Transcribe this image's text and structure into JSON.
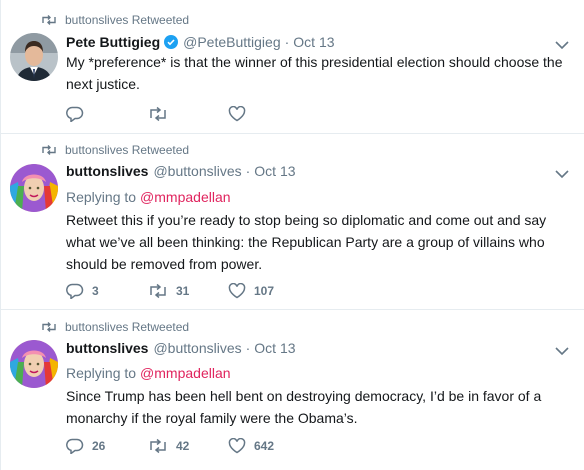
{
  "tweets": [
    {
      "retweet_label": "buttonslives Retweeted",
      "name": "Pete Buttigieg",
      "verified": true,
      "handle": "@PeteButtigieg",
      "separator": "·",
      "date": "Oct 13",
      "reply_to_prefix": "",
      "reply_to_user": "",
      "text": "My *preference* is that the winner of this presidential election should choose the next justice.",
      "counts": {
        "replies": "",
        "retweets": "",
        "likes": ""
      },
      "avatar": "photo-avatar"
    },
    {
      "retweet_label": "buttonslives Retweeted",
      "name": "buttonslives",
      "verified": false,
      "handle": "@buttonslives",
      "separator": "·",
      "date": "Oct 13",
      "reply_to_prefix": "Replying to",
      "reply_to_user": "@mmpadellan",
      "text": "Retweet this if you’re ready to stop being so diplomatic and come out and say what we’ve all been thinking: the Republican Party are a group of villains who should be removed from power.",
      "counts": {
        "replies": "3",
        "retweets": "31",
        "likes": "107"
      },
      "avatar": "rainbow-hair-avatar"
    },
    {
      "retweet_label": "buttonslives Retweeted",
      "name": "buttonslives",
      "verified": false,
      "handle": "@buttonslives",
      "separator": "·",
      "date": "Oct 13",
      "reply_to_prefix": "Replying to",
      "reply_to_user": "@mmpadellan",
      "text": "Since Trump has been hell bent on destroying democracy, I’d be in favor of a monarchy if the royal family were the Obama’s.",
      "counts": {
        "replies": "26",
        "retweets": "42",
        "likes": "642"
      },
      "avatar": "rainbow-hair-avatar"
    }
  ],
  "colors": {
    "text": "#14171a",
    "muted": "#657786",
    "mention": "#e0245e",
    "verified": "#1da1f2",
    "divider": "#e6ecf0"
  }
}
